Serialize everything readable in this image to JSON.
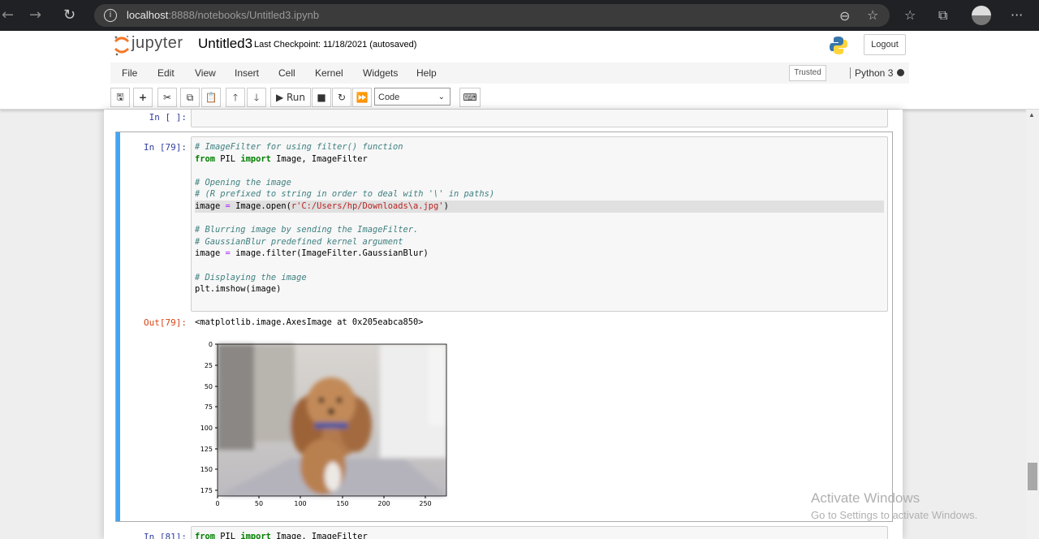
{
  "browser": {
    "url_host": "localhost",
    "url_rest": ":8888/notebooks/Untitled3.ipynb",
    "back_icon": "←",
    "forward_icon": "→",
    "reload_icon": "↻"
  },
  "header": {
    "logo_text": "jupyter",
    "notebook_title": "Untitled3",
    "checkpoint": "Last Checkpoint: 11/18/2021  (autosaved)",
    "logout_label": "Logout"
  },
  "menu": {
    "items": [
      "File",
      "Edit",
      "View",
      "Insert",
      "Cell",
      "Kernel",
      "Widgets",
      "Help"
    ],
    "trusted_label": "Trusted",
    "kernel_name": "Python 3"
  },
  "toolbar": {
    "run_label": "▶ Run",
    "cell_type": "Code"
  },
  "cells": {
    "prev_prompt": "In [ ]:",
    "current_prompt": "In [79]:",
    "out_prompt": "Out[79]:",
    "output_text": "<matplotlib.image.AxesImage at 0x205eabca850>",
    "next_prompt": "In [81]:"
  },
  "plot": {
    "x_ticks": [
      "0",
      "50",
      "100",
      "150",
      "200",
      "250"
    ],
    "y_ticks": [
      "0",
      "25",
      "50",
      "75",
      "100",
      "125",
      "150",
      "175"
    ]
  },
  "watermark": {
    "line1": "Activate Windows",
    "line2": "Go to Settings to activate Windows."
  },
  "colors": {
    "cell_selected_bar": "#42a5f5",
    "in_prompt": "#303f9f",
    "out_prompt": "#d84315"
  }
}
